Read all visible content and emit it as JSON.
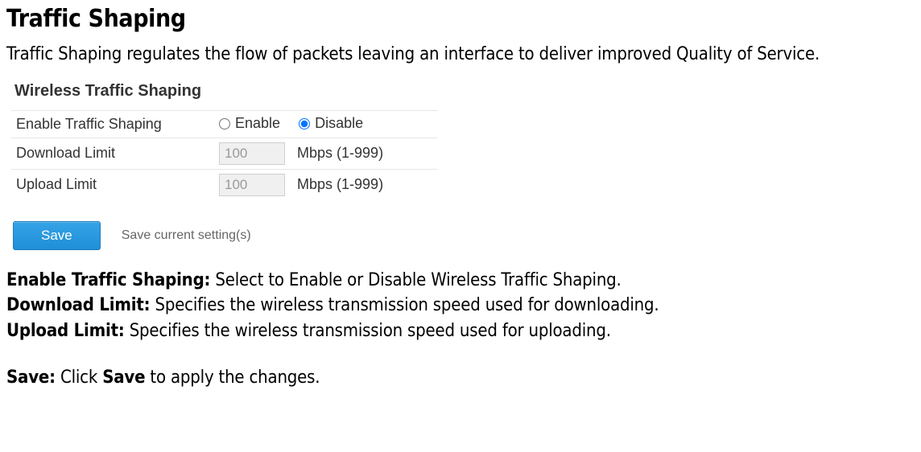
{
  "page": {
    "title": "Traffic Shaping",
    "intro": "Traffic Shaping regulates the flow of packets leaving an interface to deliver improved Quality of Service."
  },
  "panel": {
    "heading": "Wireless Traffic Shaping",
    "rows": {
      "enable": {
        "label": "Enable Traffic Shaping",
        "option_enable": "Enable",
        "option_disable": "Disable",
        "selected": "disable"
      },
      "download": {
        "label": "Download Limit",
        "value": "100",
        "unit": "Mbps (1-999)"
      },
      "upload": {
        "label": "Upload Limit",
        "value": "100",
        "unit": "Mbps (1-999)"
      }
    },
    "save_button": "Save",
    "save_caption": "Save current setting(s)"
  },
  "definitions": {
    "d1_term": "Enable Traffic Shaping:",
    "d1_text": " Select to Enable or Disable Wireless Traffic Shaping.",
    "d2_term": "Download Limit:",
    "d2_text": " Specifies the wireless transmission speed used for downloading.",
    "d3_term": "Upload Limit:",
    "d3_text": " Specifies the wireless transmission speed used for uploading.",
    "d4_term": "Save:",
    "d4_text_a": " Click ",
    "d4_text_b": "Save",
    "d4_text_c": " to apply the changes."
  }
}
